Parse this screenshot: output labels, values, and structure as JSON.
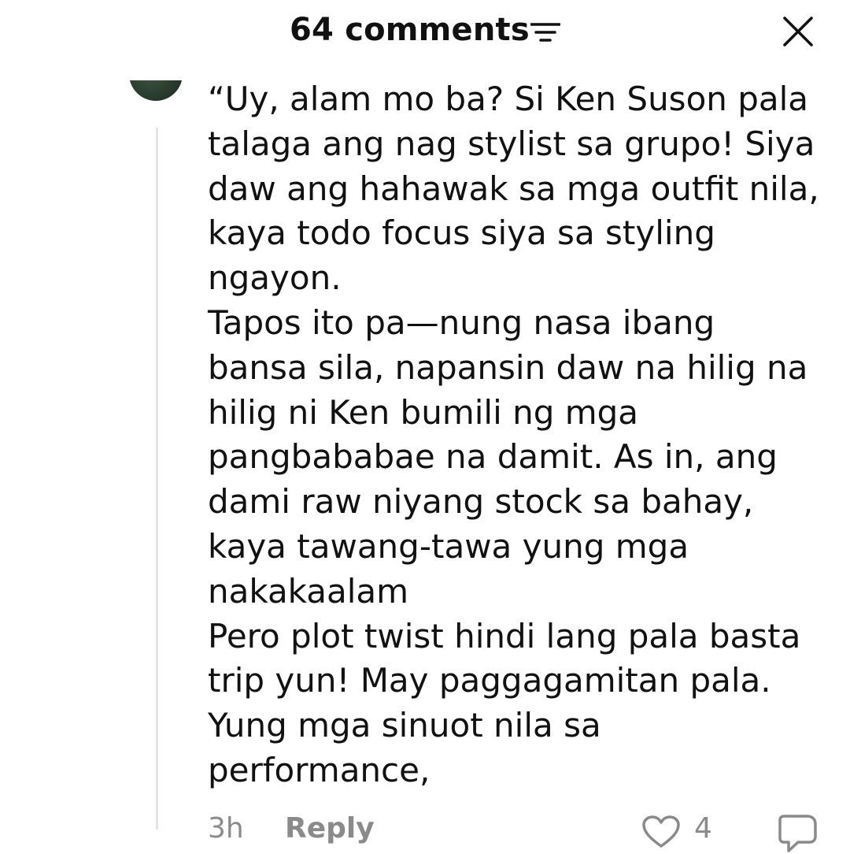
{
  "header": {
    "title": "64 comments",
    "sort_icon": "sort-icon",
    "close_icon": "close-icon"
  },
  "comment": {
    "avatar_icon": "avatar",
    "text": "“Uy, alam mo ba? Si Ken Suson pala\ntalaga ang nag stylist sa grupo! Siya\ndaw ang hahawak sa mga outfit nila,\nkaya todo focus siya sa styling\nngayon.\nTapos ito pa—nung nasa ibang\nbansa sila, napansin daw na hilig na\nhilig ni Ken bumili ng mga\npangbababae na damit. As in, ang\ndami raw niyang stock sa bahay,\nkaya tawang-tawa yung mga\nnakakaalam\nPero plot twist hindi lang pala basta\ntrip yun! May paggagamitan pala.\nYung mga sinuot nila sa\nperformance,",
    "time": "3h",
    "reply_label": "Reply",
    "like_count": "4",
    "like_icon": "heart-icon",
    "dislike_icon": "dislike-icon"
  },
  "colors": {
    "text": "#111111",
    "muted": "#8a8a8a",
    "thread_line": "#e3e3e3"
  }
}
